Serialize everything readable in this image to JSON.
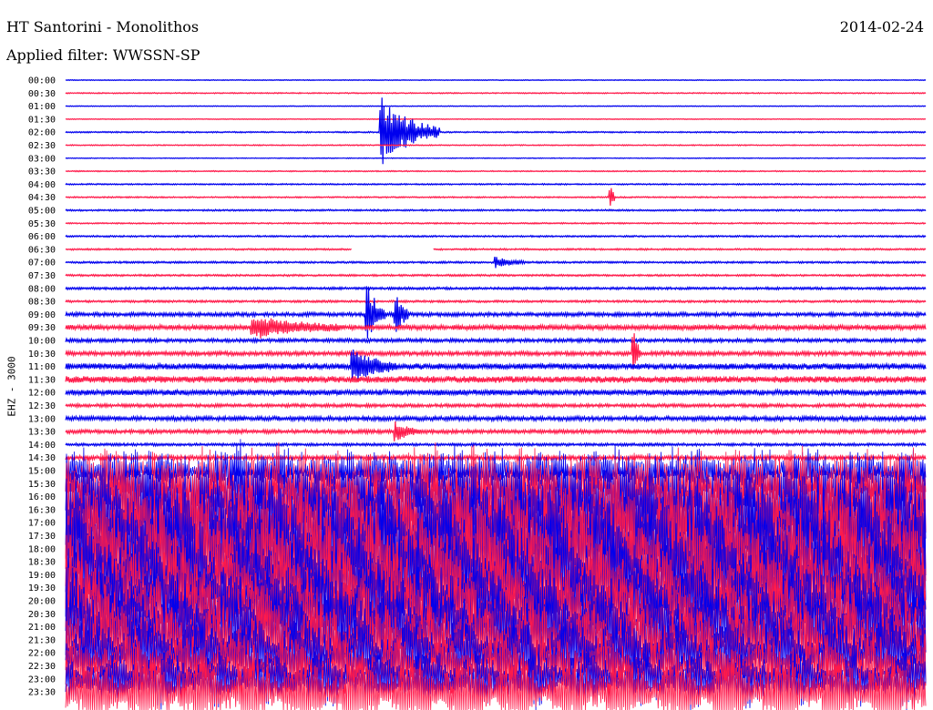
{
  "header": {
    "title": "HT Santorini - Monolithos",
    "date": "2014-02-24",
    "filter": "Applied filter: WWSSN-SP"
  },
  "colors": {
    "even_trace": "#0000ee",
    "odd_trace": "#ff1a4a",
    "background": "#ffffff"
  },
  "chart_data": {
    "type": "line",
    "title": "HT Santorini - Monolithos",
    "ylabel": "EHZ - 3000",
    "xlabel": "",
    "row_labels": [
      "00:00",
      "00:30",
      "01:00",
      "01:30",
      "02:00",
      "02:30",
      "03:00",
      "03:30",
      "04:00",
      "04:30",
      "05:00",
      "05:30",
      "06:00",
      "06:30",
      "07:00",
      "07:30",
      "08:00",
      "08:30",
      "09:00",
      "09:30",
      "10:00",
      "10:30",
      "11:00",
      "11:30",
      "12:00",
      "12:30",
      "13:00",
      "13:30",
      "14:00",
      "14:30",
      "15:00",
      "15:30",
      "16:00",
      "16:30",
      "17:00",
      "17:30",
      "18:00",
      "18:30",
      "19:00",
      "19:30",
      "20:00",
      "20:30",
      "21:00",
      "21:30",
      "22:00",
      "22:30",
      "23:00",
      "23:30"
    ],
    "row_noise_level": [
      0.3,
      0.4,
      0.3,
      0.3,
      0.5,
      0.4,
      0.3,
      0.4,
      0.5,
      0.5,
      0.6,
      0.5,
      0.6,
      0.6,
      0.7,
      0.7,
      0.9,
      0.8,
      1.4,
      1.8,
      1.3,
      1.5,
      2.2,
      2.4,
      2.0,
      1.2,
      1.6,
      1.4,
      1.0,
      1.5,
      8,
      14,
      20,
      24,
      26,
      28,
      30,
      26,
      22,
      20,
      18,
      20,
      22,
      18,
      16,
      14,
      12,
      16
    ],
    "events": [
      {
        "row": 4,
        "minute": 11.0,
        "amplitude": 26,
        "duration_min": 2.0
      },
      {
        "row": 9,
        "minute": 19.0,
        "amplitude": 14,
        "duration_min": 0.1
      },
      {
        "row": 14,
        "minute": 15.0,
        "amplitude": 4,
        "duration_min": 1.0
      },
      {
        "row": 18,
        "minute": 10.5,
        "amplitude": 24,
        "duration_min": 0.6
      },
      {
        "row": 18,
        "minute": 11.5,
        "amplitude": 16,
        "duration_min": 0.4
      },
      {
        "row": 19,
        "minute": 6.5,
        "amplitude": 8,
        "duration_min": 3.0
      },
      {
        "row": 21,
        "minute": 19.8,
        "amplitude": 18,
        "duration_min": 0.2
      },
      {
        "row": 22,
        "minute": 10.0,
        "amplitude": 12,
        "duration_min": 1.5
      },
      {
        "row": 27,
        "minute": 11.5,
        "amplitude": 7,
        "duration_min": 0.8
      }
    ],
    "gaps": [
      {
        "row": 13,
        "from_minute": 10.0,
        "to_minute": 12.8
      }
    ]
  }
}
